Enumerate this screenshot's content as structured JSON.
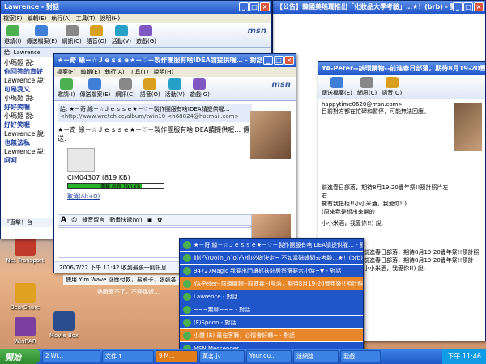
{
  "windows": {
    "top_right": {
      "title": "【公告】韓國美瑤珊推出「化妝品大學考驗」…★！(brb) - 對話"
    },
    "top_left": {
      "title": "Lawrence - 對話",
      "menu": [
        "檔案(F)",
        "編輯(E)",
        "執行(A)",
        "工具(T)",
        "說明(H)"
      ]
    },
    "left_behind": {
      "to_label": "給: Lawrence",
      "lines": [
        "小瑪姬 說:",
        "你回答的真好",
        "Lawrence 說:",
        "可是我又",
        "小瑪姬 說:",
        "好好笑喔",
        "小瑪姬 說:",
        "好好笑喔",
        "Lawrence 說:",
        "也無法私",
        "Lawrence 說:",
        "呵呵"
      ],
      "footer": "『直擊！台"
    },
    "right_behind": {
      "contact": "happytime0620@msn.com>",
      "notice": "目前對方都在忙碌和暫停，可能無法回應。",
      "message_title": "YA-Peter--該環購物--前進春日部落，期待8月19-20豐年祭!!預計照片左右",
      "body_lines": [
        "前進春日部落，期待8月19-20豐年祭!!預計照片左右",
        "擁有我抵柜!!小小米酒，我愛你!!)",
        "(原來我是想出來開的"
      ],
      "body_lines2": [
        "小小米酒，我愛你!!) 說:"
      ],
      "body_lines3": [
        "前進春日部落，期待8月19-20豐年祭!!預計照",
        "前進春日部落，期待8月19-20豐年祭!!預計",
        "小小米酒，我愛你!!) 說:"
      ]
    },
    "main": {
      "title": "★－奇 緣－☆Ｊｅｓｓｅ★－♡－製作團服有啥IDEA請提供喔… - 對話",
      "menu": [
        "檔案(F)",
        "編輯(E)",
        "執行(A)",
        "工具(T)",
        "說明(H)"
      ],
      "toolbar": [
        "邀請(I)",
        "傳送檔案(E)",
        "網訊(C)",
        "語音(O)",
        "活動(V)",
        "遊戲(G)"
      ],
      "to_label": "給:",
      "to_value": "★－奇 緣－☆Ｊｅｓｓｅ★－♡－製作團服有啥IDEA請提供喔…",
      "to_email": "<http://www.wretch.cc/album/twin10 <h68824@hotmail.com>",
      "msg_sender": "★－奇 緣－☆Ｊｅｓｓｅ★－♡－製作團服有啥IDEA請提供喔… 傳送:",
      "file_name": "CIM04307 (819 KB)",
      "progress_label": "傳輸 尚餘 190 KB",
      "progress_fraction": 0.77,
      "cancel_label": "取消(Alt+Q)",
      "format_bar": [
        "錄音留言",
        "動畫快遞(W)"
      ],
      "status": "2006/7/22 下午 11:42 收到最後一則訊息"
    }
  },
  "background_text": [
    "使用 Yim Wave 感應付款，易刷卡、張張各…",
    "熱戰愛不了，不怪瑪姬…"
  ],
  "popup": {
    "items": [
      {
        "label": "★－奇 緣－☆Ｊｅｓｓｅ★－♡－製作團服有啥IDEA請提供喔… - 對",
        "highlight": false
      },
      {
        "label": "仙(凸)Oo(∩_∩)o(凸)仙必做決定~ 不如當磁峰聞去考驗…★！(brb) - 對",
        "highlight": false
      },
      {
        "label": "94727Magic 我要出門讓抓扶駐居然還要六小時~▼ - 對話",
        "highlight": false
      },
      {
        "label": "YA-Peter--該環購物--前進春日部落，期待8月19-20豐年祭!!預計照",
        "highlight": true
      },
      {
        "label": "Lawrence - 對話",
        "highlight": false
      },
      {
        "label": "~~~無聊~~~ - 對話",
        "highlight": false
      },
      {
        "label": "(F)Spoon - 對話",
        "highlight": false
      },
      {
        "label": "小雜 (E) 最在客舞，心情會好轉~ - 對話",
        "highlight": true
      },
      {
        "label": "MSN Messenger",
        "highlight": false
      }
    ]
  },
  "taskbar": {
    "start_label": "開始",
    "buttons": [
      "2 Wi...",
      "文件 1...",
      "9 M...",
      "萬名小...",
      "Your qu...",
      "迷網路...",
      "我戲..."
    ],
    "active_index": 2,
    "clock": "下午 11:46"
  },
  "desktop_icons": [
    "Net Transport",
    "BearShare",
    "Movie Box",
    "WinRAR"
  ],
  "colors": {
    "titlebar": "#1f55c9",
    "highlight": "#e8862a",
    "progress": "#27b327"
  }
}
